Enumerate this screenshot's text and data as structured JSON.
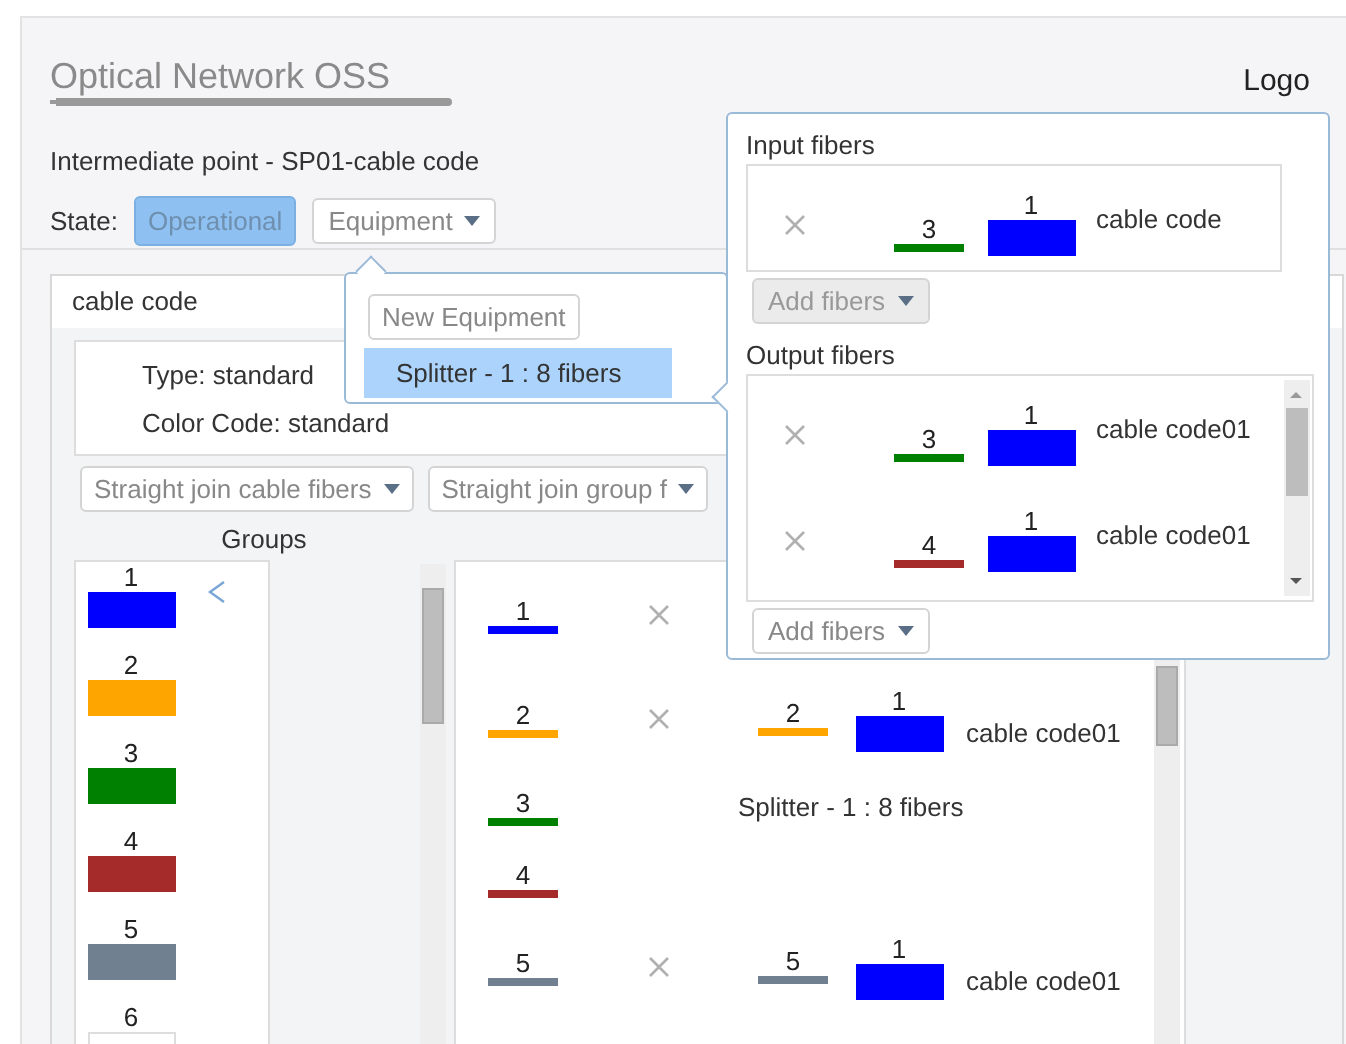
{
  "header": {
    "title": "Optical Network OSS",
    "logo": "Logo"
  },
  "point_title": "Intermediate point - SP01-cable code",
  "state": {
    "label": "State:",
    "value": "Operational"
  },
  "equipment_button": {
    "label": "Equipment"
  },
  "equipment_menu": {
    "new_button": "New Equipment",
    "items": [
      {
        "label": "Splitter - 1 : 8 fibers",
        "selected": true
      }
    ]
  },
  "cable_panel": {
    "title": "cable code",
    "type": "Type: standard",
    "color_code": "Color Code: standard",
    "join_buttons": [
      "Straight join cable fibers",
      "Straight join group f"
    ],
    "groups_label": "Groups",
    "groups": [
      {
        "number": "1",
        "color": "#0000ff",
        "selected": true
      },
      {
        "number": "2",
        "color": "#ffa500",
        "selected": false
      },
      {
        "number": "3",
        "color": "#008000",
        "selected": false
      },
      {
        "number": "4",
        "color": "#a52a2a",
        "selected": false
      },
      {
        "number": "5",
        "color": "#708090",
        "selected": false
      },
      {
        "number": "6",
        "color": "#ffffff",
        "selected": false
      }
    ],
    "fibers": [
      {
        "number": "1",
        "color": "#0000ff",
        "removable": true
      },
      {
        "number": "2",
        "color": "#ffa500",
        "removable": true,
        "link": {
          "number": "2",
          "color": "#ffa500",
          "group": {
            "number": "1",
            "color": "#0000ff"
          },
          "cable": "cable code01"
        }
      },
      {
        "number": "3",
        "color": "#008000",
        "removable": false,
        "equipment": "Splitter - 1 : 8 fibers"
      },
      {
        "number": "4",
        "color": "#a52a2a",
        "removable": false
      },
      {
        "number": "5",
        "color": "#708090",
        "removable": true,
        "link": {
          "number": "5",
          "color": "#708090",
          "group": {
            "number": "1",
            "color": "#0000ff"
          },
          "cable": "cable code01"
        }
      }
    ]
  },
  "splitter_popup": {
    "input_title": "Input fibers",
    "inputs": [
      {
        "number": "3",
        "color": "#008000",
        "group": {
          "number": "1",
          "color": "#0000ff"
        },
        "cable": "cable code"
      }
    ],
    "input_add": {
      "label": "Add fibers",
      "disabled": true
    },
    "output_title": "Output fibers",
    "outputs": [
      {
        "number": "3",
        "color": "#008000",
        "group": {
          "number": "1",
          "color": "#0000ff"
        },
        "cable": "cable code01"
      },
      {
        "number": "4",
        "color": "#a52a2a",
        "group": {
          "number": "1",
          "color": "#0000ff"
        },
        "cable": "cable code01"
      }
    ],
    "output_add": {
      "label": "Add fibers",
      "disabled": false
    }
  }
}
